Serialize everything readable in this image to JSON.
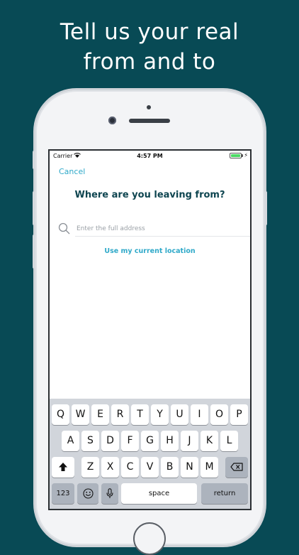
{
  "headline": {
    "line1": "Tell us your real",
    "line2": "from and to"
  },
  "status_bar": {
    "carrier": "Carrier",
    "time": "4:57 PM"
  },
  "screen": {
    "cancel_label": "Cancel",
    "title": "Where are you leaving from?",
    "search_placeholder": "Enter the full address",
    "current_location_label": "Use my current location"
  },
  "keyboard": {
    "row1": [
      "Q",
      "W",
      "E",
      "R",
      "T",
      "Y",
      "U",
      "I",
      "O",
      "P"
    ],
    "row2": [
      "A",
      "S",
      "D",
      "F",
      "G",
      "H",
      "J",
      "K",
      "L"
    ],
    "row3": [
      "Z",
      "X",
      "C",
      "V",
      "B",
      "N",
      "M"
    ],
    "numbers_label": "123",
    "space_label": "space",
    "return_label": "return"
  },
  "colors": {
    "background": "#084a55",
    "accent": "#2fa9c9",
    "title": "#0e4550"
  },
  "icons": [
    "wifi-icon",
    "battery-icon",
    "search-icon",
    "shift-icon",
    "delete-icon",
    "emoji-icon",
    "microphone-icon"
  ]
}
